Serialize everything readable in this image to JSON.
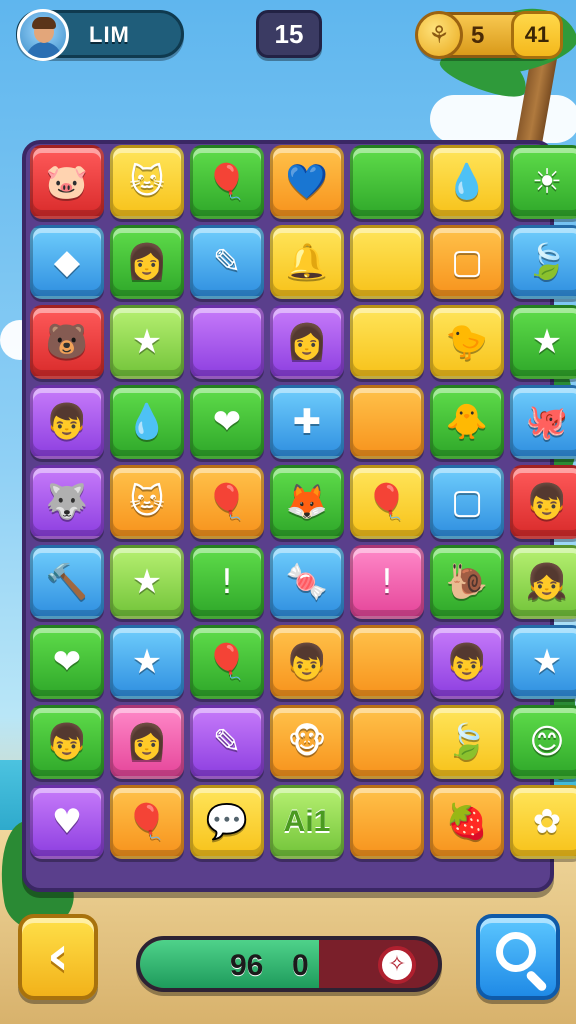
{
  "header": {
    "player_name": "LIM",
    "level": "15",
    "coins": "5",
    "moves": "41",
    "avatar_icon": "player-avatar",
    "coin_icon": "gold-coin-icon"
  },
  "board": {
    "tiles": [
      {
        "color": "red",
        "icon": "🐷",
        "name": "pig-icon"
      },
      {
        "color": "yellow",
        "icon": "🐱",
        "name": "cat-icon"
      },
      {
        "color": "green",
        "icon": "🎈",
        "name": "balloon-icon"
      },
      {
        "color": "orange",
        "icon": "💙",
        "name": "heart-icon"
      },
      {
        "color": "green",
        "icon": "",
        "name": "plain-tile"
      },
      {
        "color": "yellow",
        "icon": "💧",
        "name": "drop-icon"
      },
      {
        "color": "green",
        "icon": "☀",
        "name": "sun-icon"
      },
      {
        "color": "blue",
        "icon": "◆",
        "name": "gem-icon"
      },
      {
        "color": "green",
        "icon": "👩",
        "name": "girl-face-icon"
      },
      {
        "color": "blue",
        "icon": "✎",
        "name": "pencil-icon"
      },
      {
        "color": "yellow",
        "icon": "🔔",
        "name": "bell-icon"
      },
      {
        "color": "yellow",
        "icon": "",
        "name": "plain-tile"
      },
      {
        "color": "orange",
        "icon": "▢",
        "name": "glass-block-icon"
      },
      {
        "color": "blue",
        "icon": "🍃",
        "name": "leaf-icon"
      },
      {
        "color": "red",
        "icon": "🐻",
        "name": "bear-icon"
      },
      {
        "color": "lime",
        "icon": "★",
        "name": "star-icon"
      },
      {
        "color": "purple",
        "icon": "",
        "name": "plain-tile"
      },
      {
        "color": "purple",
        "icon": "👩",
        "name": "girl-face-icon"
      },
      {
        "color": "yellow",
        "icon": "",
        "name": "plain-tile"
      },
      {
        "color": "yellow",
        "icon": "🐤",
        "name": "chick-icon"
      },
      {
        "color": "green",
        "icon": "★",
        "name": "star-icon"
      },
      {
        "color": "purple",
        "icon": "👦",
        "name": "boy-face-icon"
      },
      {
        "color": "green",
        "icon": "💧",
        "name": "drop-icon"
      },
      {
        "color": "green",
        "icon": "❤",
        "name": "heart-icon"
      },
      {
        "color": "blue",
        "icon": "✚",
        "name": "bandage-icon"
      },
      {
        "color": "orange",
        "icon": "",
        "name": "plain-tile"
      },
      {
        "color": "green",
        "icon": "🐥",
        "name": "chick-icon"
      },
      {
        "color": "blue",
        "icon": "🐙",
        "name": "creature-icon"
      },
      {
        "color": "purple",
        "icon": "🐺",
        "name": "wolf-icon"
      },
      {
        "color": "orange",
        "icon": "🐱",
        "name": "cat-icon"
      },
      {
        "color": "orange",
        "icon": "🎈",
        "name": "balloon-icon"
      },
      {
        "color": "green",
        "icon": "🦊",
        "name": "fox-icon"
      },
      {
        "color": "yellow",
        "icon": "🎈",
        "name": "balloon-icon"
      },
      {
        "color": "blue",
        "icon": "▢",
        "name": "screen-icon"
      },
      {
        "color": "red",
        "icon": "👦",
        "name": "boy-face-icon"
      },
      {
        "color": "blue",
        "icon": "🔨",
        "name": "hammer-icon"
      },
      {
        "color": "lime",
        "icon": "★",
        "name": "star-icon"
      },
      {
        "color": "green",
        "icon": "!",
        "name": "exclamation-icon"
      },
      {
        "color": "blue",
        "icon": "🍬",
        "name": "candy-icon"
      },
      {
        "color": "pink",
        "icon": "!",
        "name": "exclamation-icon"
      },
      {
        "color": "green",
        "icon": "🐌",
        "name": "snail-icon"
      },
      {
        "color": "lime",
        "icon": "👧",
        "name": "girl-face-icon"
      },
      {
        "color": "green",
        "icon": "❤",
        "name": "heart-icon"
      },
      {
        "color": "blue",
        "icon": "★",
        "name": "star-icon"
      },
      {
        "color": "green",
        "icon": "🎈",
        "name": "balloon-icon"
      },
      {
        "color": "orange",
        "icon": "👦",
        "name": "boy-face-icon"
      },
      {
        "color": "orange",
        "icon": "",
        "name": "plain-tile"
      },
      {
        "color": "purple",
        "icon": "👦",
        "name": "boy-face-icon"
      },
      {
        "color": "blue",
        "icon": "★",
        "name": "star-icon"
      },
      {
        "color": "green",
        "icon": "👦",
        "name": "boy-face-icon"
      },
      {
        "color": "pink",
        "icon": "👩",
        "name": "girl-face-icon"
      },
      {
        "color": "purple",
        "icon": "✎",
        "name": "pen-tablet-icon"
      },
      {
        "color": "orange",
        "icon": "🐵",
        "name": "monkey-icon"
      },
      {
        "color": "orange",
        "icon": "",
        "name": "plain-tile"
      },
      {
        "color": "yellow",
        "icon": "🍃",
        "name": "leaf-icon"
      },
      {
        "color": "green",
        "icon": "😊",
        "name": "smiley-icon"
      },
      {
        "color": "purple",
        "icon": "♥",
        "name": "shield-icon"
      },
      {
        "color": "orange",
        "icon": "🎈",
        "name": "balloon-icon"
      },
      {
        "color": "yellow",
        "icon": "💬",
        "name": "speech-bubble-icon"
      },
      {
        "color": "lime",
        "text": "Ai1",
        "name": "ai1-tile"
      },
      {
        "color": "orange",
        "icon": "",
        "name": "plain-tile"
      },
      {
        "color": "orange",
        "icon": "🍓",
        "name": "berry-icon"
      },
      {
        "color": "yellow",
        "icon": "✿",
        "name": "flower-icon"
      }
    ]
  },
  "footer": {
    "back_icon": "‹",
    "score": "96",
    "zero": "0",
    "progress": 0.6,
    "target_icon": "✧"
  }
}
